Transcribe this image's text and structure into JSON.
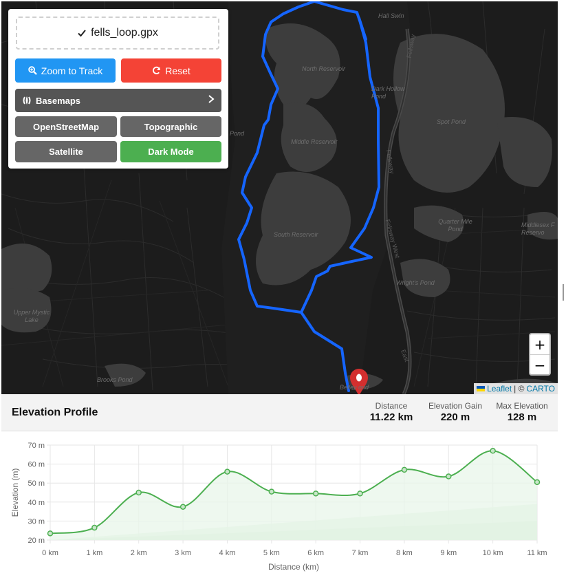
{
  "file": {
    "icon": "check-icon",
    "name": "fells_loop.gpx"
  },
  "buttons": {
    "zoom": {
      "icon": "search-plus-icon",
      "label": "Zoom to Track"
    },
    "reset": {
      "icon": "refresh-icon",
      "label": "Reset"
    }
  },
  "basemaps": {
    "label": "Basemaps",
    "icon": "layers-icon",
    "options": [
      "OpenStreetMap",
      "Topographic",
      "Satellite",
      "Dark Mode"
    ],
    "active": "Dark Mode"
  },
  "map_labels": {
    "hall_swin": "Hall Swin",
    "north_reservoir": "North Reservoir",
    "dark_hollow_pond": "Dark Hollow Pond",
    "spot_pond": "Spot Pond",
    "middle_reservoir": "Middle Reservoir",
    "pond": "Pond",
    "south_reservoir": "South Reservoir",
    "quarter_mile_pond": "Quarter Mile Pond",
    "middlesex_fells_reservation": "Middlesex F Reservo",
    "wrights_pond": "Wright's Pond",
    "upper_mystic_lake": "Upper Mystic Lake",
    "brooks_pond": "Brooks Pond",
    "bellevue_pond": "Bellev   ond",
    "fellsway": "Fellsway",
    "fellsway_west": "Fellsway West",
    "east": "East"
  },
  "map_controls": {
    "zoom_in": "+",
    "zoom_out": "−"
  },
  "attribution": {
    "leaflet": "Leaflet",
    "sep": "| ©",
    "carto": "CARTO"
  },
  "elevation": {
    "title": "Elevation Profile",
    "stats": [
      {
        "label": "Distance",
        "value": "11.22 km"
      },
      {
        "label": "Elevation Gain",
        "value": "220 m"
      },
      {
        "label": "Max Elevation",
        "value": "128 m"
      }
    ]
  },
  "chart_data": {
    "type": "line",
    "x": [
      0,
      1,
      2,
      3,
      4,
      5,
      6,
      7,
      8,
      9,
      10,
      11
    ],
    "series": [
      {
        "values": [
          23.5,
          26.5,
          45,
          37.5,
          56,
          45.5,
          44.5,
          44.5,
          57,
          53.5,
          67,
          50.5
        ]
      }
    ],
    "xlim": [
      0,
      11
    ],
    "ylim": [
      20,
      70
    ],
    "xticks": [
      "0 km",
      "1 km",
      "2 km",
      "3 km",
      "4 km",
      "5 km",
      "6 km",
      "7 km",
      "8 km",
      "9 km",
      "10 km",
      "11 km"
    ],
    "yticks": [
      "20 m",
      "30 m",
      "40 m",
      "50 m",
      "60 m",
      "70 m"
    ],
    "xlabel": "Distance (km)",
    "ylabel": "Elevation (m)",
    "grid": true,
    "colors": {
      "line": "#4caf50",
      "fill": "#e8f5e9"
    }
  }
}
